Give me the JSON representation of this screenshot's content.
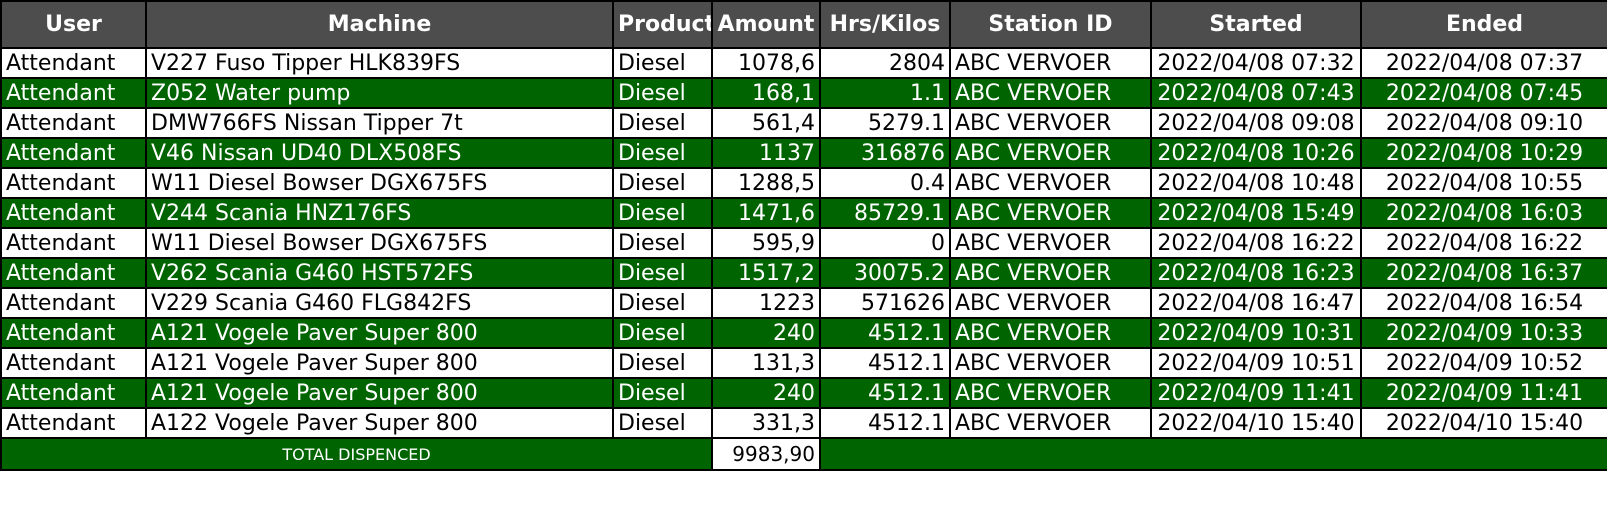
{
  "headers": [
    "User",
    "Machine",
    "Product",
    "Amount",
    "Hrs/Kilos",
    "Station ID",
    "Started",
    "Ended"
  ],
  "rows": [
    [
      "Attendant",
      "V227 Fuso Tipper HLK839FS",
      "Diesel",
      "1078,6",
      "2804",
      "ABC VERVOER",
      "2022/04/08 07:32",
      "2022/04/08 07:37"
    ],
    [
      "Attendant",
      "Z052 Water pump",
      "Diesel",
      "168,1",
      "1.1",
      "ABC VERVOER",
      "2022/04/08 07:43",
      "2022/04/08 07:45"
    ],
    [
      "Attendant",
      "DMW766FS Nissan Tipper 7t",
      "Diesel",
      "561,4",
      "5279.1",
      "ABC VERVOER",
      "2022/04/08 09:08",
      "2022/04/08 09:10"
    ],
    [
      "Attendant",
      "V46 Nissan UD40 DLX508FS",
      "Diesel",
      "1137",
      "316876",
      "ABC VERVOER",
      "2022/04/08 10:26",
      "2022/04/08 10:29"
    ],
    [
      "Attendant",
      "W11 Diesel Bowser DGX675FS",
      "Diesel",
      "1288,5",
      "0.4",
      "ABC VERVOER",
      "2022/04/08 10:48",
      "2022/04/08 10:55"
    ],
    [
      "Attendant",
      "V244 Scania HNZ176FS",
      "Diesel",
      "1471,6",
      "85729.1",
      "ABC VERVOER",
      "2022/04/08 15:49",
      "2022/04/08 16:03"
    ],
    [
      "Attendant",
      "W11 Diesel Bowser DGX675FS",
      "Diesel",
      "595,9",
      "0",
      "ABC VERVOER",
      "2022/04/08 16:22",
      "2022/04/08 16:22"
    ],
    [
      "Attendant",
      "V262 Scania G460 HST572FS",
      "Diesel",
      "1517,2",
      "30075.2",
      "ABC VERVOER",
      "2022/04/08 16:23",
      "2022/04/08 16:37"
    ],
    [
      "Attendant",
      "V229 Scania G460 FLG842FS",
      "Diesel",
      "1223",
      "571626",
      "ABC VERVOER",
      "2022/04/08 16:47",
      "2022/04/08 16:54"
    ],
    [
      "Attendant",
      "A121 Vogele Paver Super 800",
      "Diesel",
      "240",
      "4512.1",
      "ABC VERVOER",
      "2022/04/09 10:31",
      "2022/04/09 10:33"
    ],
    [
      "Attendant",
      "A121 Vogele Paver Super 800",
      "Diesel",
      "131,3",
      "4512.1",
      "ABC VERVOER",
      "2022/04/09 10:51",
      "2022/04/09 10:52"
    ],
    [
      "Attendant",
      "A121 Vogele Paver Super 800",
      "Diesel",
      "240",
      "4512.1",
      "ABC VERVOER",
      "2022/04/09 11:41",
      "2022/04/09 11:41"
    ],
    [
      "Attendant",
      "A122 Vogele Paver Super 800",
      "Diesel",
      "331,3",
      "4512.1",
      "ABC VERVOER",
      "2022/04/10 15:40",
      "2022/04/10 15:40"
    ]
  ],
  "total": {
    "label": "TOTAL DISPENCED",
    "value": "9983,90"
  },
  "colors": {
    "header_bg": "#4d4d4d",
    "stripe_green": "#006400",
    "row_white": "#ffffff"
  }
}
